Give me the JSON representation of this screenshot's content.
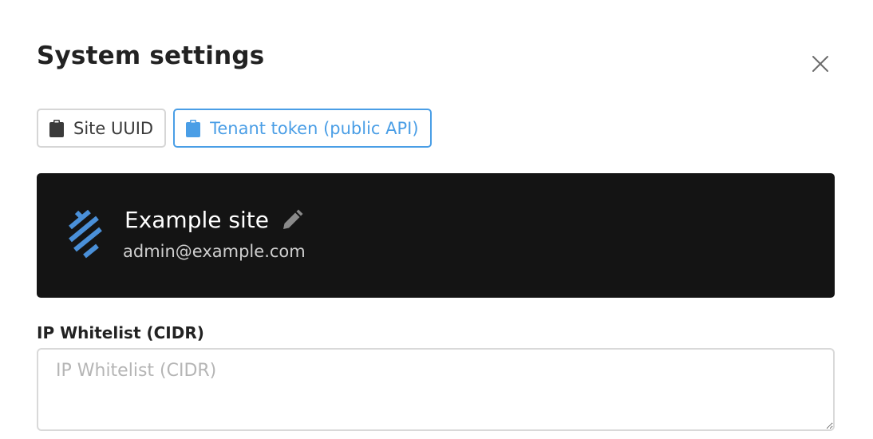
{
  "dialog": {
    "title": "System settings",
    "close_icon": "close-icon"
  },
  "buttons": {
    "site_uuid_label": "Site UUID",
    "tenant_token_label": "Tenant token (public API)",
    "icon": "clipboard-icon",
    "accent_color": "#4a9ee6"
  },
  "site": {
    "name": "Example site",
    "email": "admin@example.com",
    "logo_color": "#4a90d9"
  },
  "ip_whitelist": {
    "label": "IP Whitelist (CIDR)",
    "value": "",
    "placeholder": "IP Whitelist (CIDR)"
  }
}
